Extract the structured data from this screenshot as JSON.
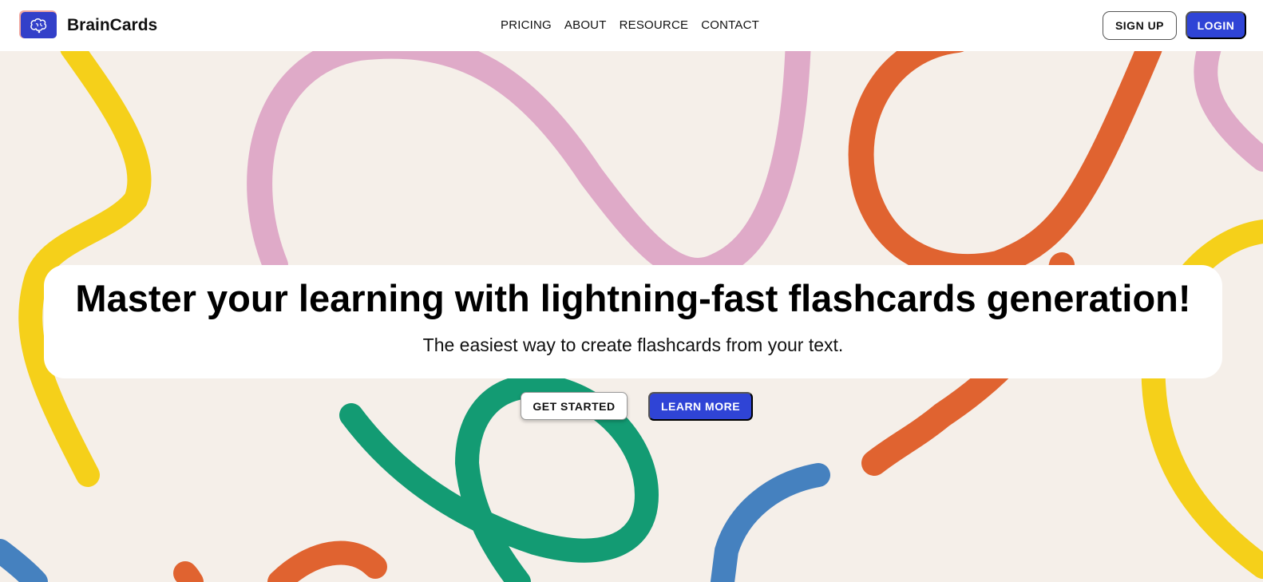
{
  "header": {
    "brand": "BrainCards",
    "logo_icon": "brain-icon",
    "nav": [
      "PRICING",
      "ABOUT",
      "RESOURCE",
      "CONTACT"
    ],
    "signup_label": "SIGN UP",
    "login_label": "LOGIN"
  },
  "hero": {
    "title": "Master your learning with lightning-fast flashcards generation!",
    "subtitle": "The easiest way to create flashcards from your text.",
    "primary_cta": "GET STARTED",
    "secondary_cta": "LEARN MORE"
  },
  "colors": {
    "accent": "#2f44d6",
    "background": "#f5efe9",
    "squiggle_yellow": "#f5d01a",
    "squiggle_pink": "#dfaac8",
    "squiggle_orange": "#e06330",
    "squiggle_green": "#139b73",
    "squiggle_blue": "#4581bf"
  }
}
